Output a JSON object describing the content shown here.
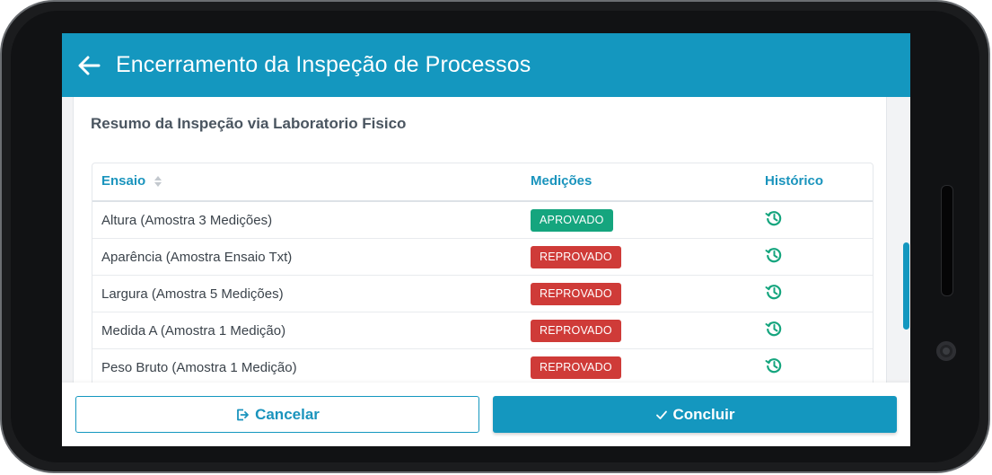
{
  "header": {
    "title": "Encerramento da Inspeção de Processos",
    "back_icon": "arrow-left-icon"
  },
  "summary": {
    "title": "Resumo da Inspeção via Laboratorio Fisico",
    "columns": [
      "Ensaio",
      "Medições",
      "Histórico"
    ],
    "rows": [
      {
        "ensaio": "Altura (Amostra 3 Medições)",
        "status": "APROVADO",
        "status_type": "ok"
      },
      {
        "ensaio": "Aparência (Amostra Ensaio Txt)",
        "status": "REPROVADO",
        "status_type": "nok"
      },
      {
        "ensaio": "Largura (Amostra 5 Medições)",
        "status": "REPROVADO",
        "status_type": "nok"
      },
      {
        "ensaio": "Medida A (Amostra 1 Medição)",
        "status": "REPROVADO",
        "status_type": "nok"
      },
      {
        "ensaio": "Peso Bruto (Amostra 1 Medição)",
        "status": "REPROVADO",
        "status_type": "nok"
      }
    ]
  },
  "footer": {
    "cancel_label": "Cancelar",
    "confirm_label": "Concluir"
  },
  "colors": {
    "primary": "#1497bf",
    "approved": "#15a57e",
    "rejected": "#cf3b38",
    "history_icon": "#15a57e"
  }
}
